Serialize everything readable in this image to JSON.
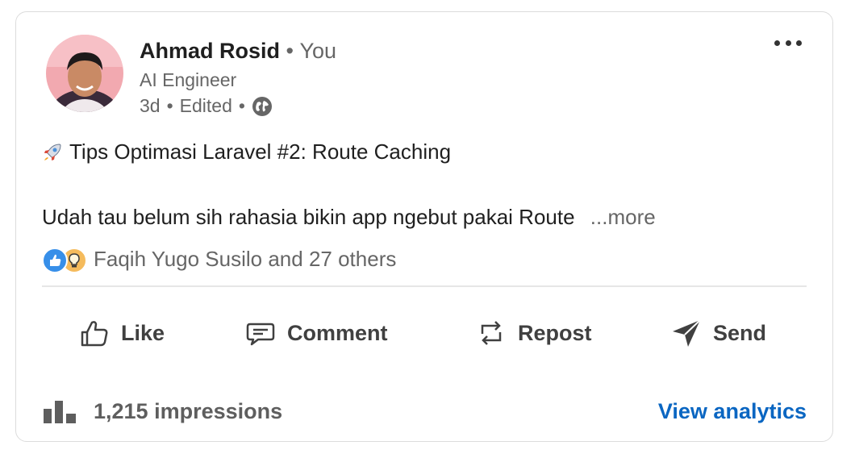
{
  "post": {
    "author": {
      "name": "Ahmad Rosid",
      "separator": "•",
      "relation": "You",
      "headline": "AI Engineer",
      "time": "3d",
      "edited": "Edited",
      "visibility_icon": "globe-icon"
    },
    "title": "Tips Optimasi Laravel #2: Route Caching",
    "title_icon": "rocket-icon",
    "body": "Udah tau belum sih rahasia bikin app ngebut pakai Route",
    "see_more": "...more",
    "reactions": {
      "icons": [
        "like-reaction-icon",
        "insightful-reaction-icon"
      ],
      "text": "Faqih Yugo Susilo and 27 others"
    }
  },
  "actions": {
    "like": "Like",
    "comment": "Comment",
    "repost": "Repost",
    "send": "Send"
  },
  "footer": {
    "impressions": "1,215 impressions",
    "analytics_link": "View analytics"
  },
  "colors": {
    "link": "#0a66c2",
    "text_primary": "#1f1f1f",
    "text_secondary": "#666666"
  }
}
